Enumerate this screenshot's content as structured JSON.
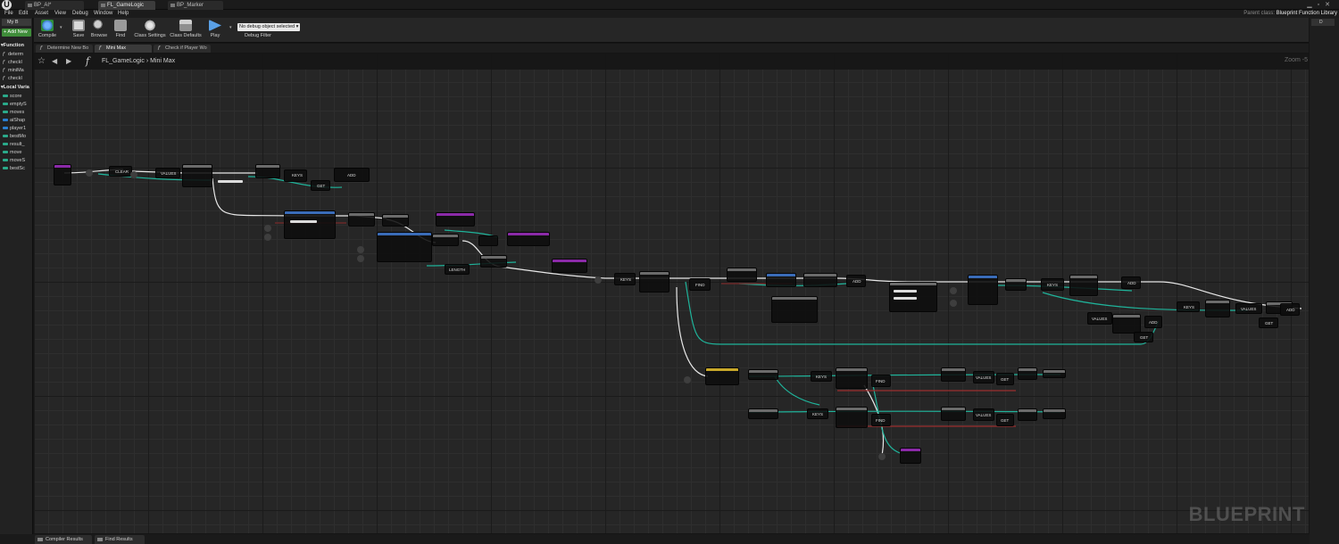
{
  "app": {
    "doc_tabs": [
      "BP_AI*",
      "FL_GameLogic",
      "BP_Marker"
    ],
    "parent_class_label": "Parent class:",
    "parent_class_value": "Blueprint Function Library"
  },
  "menu": [
    "File",
    "Edit",
    "Asset",
    "View",
    "Debug",
    "Window",
    "Help"
  ],
  "toolbar": {
    "compile": "Compile",
    "save": "Save",
    "browse": "Browse",
    "find": "Find",
    "class_settings": "Class Settings",
    "class_defaults": "Class Defaults",
    "play": "Play",
    "debug_object": "No debug object selected",
    "debug_filter": "Debug Filter"
  },
  "left_panel": {
    "my_blueprint": "My B",
    "add_new": "+ Add New",
    "functions_header": "Function",
    "functions": [
      "determ",
      "checkI",
      "miniMa",
      "checkI"
    ],
    "local_vars_header": "Local Varia",
    "local_vars": [
      {
        "name": "score",
        "color": "#2aaa8a"
      },
      {
        "name": "emptyS",
        "color": "#2aaa8a"
      },
      {
        "name": "moves",
        "color": "#2aaa8a"
      },
      {
        "name": "aiShap",
        "color": "#2a7fd0"
      },
      {
        "name": "player1",
        "color": "#2a7fd0"
      },
      {
        "name": "bestMo",
        "color": "#2aaa8a"
      },
      {
        "name": "result_",
        "color": "#2aaa8a"
      },
      {
        "name": "move",
        "color": "#2aaa8a"
      },
      {
        "name": "moveS",
        "color": "#2aaa8a"
      },
      {
        "name": "bestSc",
        "color": "#2aaa8a"
      }
    ]
  },
  "graph_tabs": [
    "Determine New Bo",
    "Mini Max",
    "Check if Player Wo"
  ],
  "breadcrumb": {
    "root": "FL_GameLogic",
    "separator": "›",
    "current": "Mini Max"
  },
  "zoom": "Zoom -5",
  "watermark": "BLUEPRINT",
  "nodes": {
    "clear": "CLEAR",
    "values": "VALUES",
    "keys": "KEYS",
    "get": "GET",
    "add": "ADD",
    "length": "LENGTH",
    "find": "FIND"
  },
  "bottom_tabs": [
    "Compiler Results",
    "Find Results"
  ],
  "right_panel_tab": "D"
}
